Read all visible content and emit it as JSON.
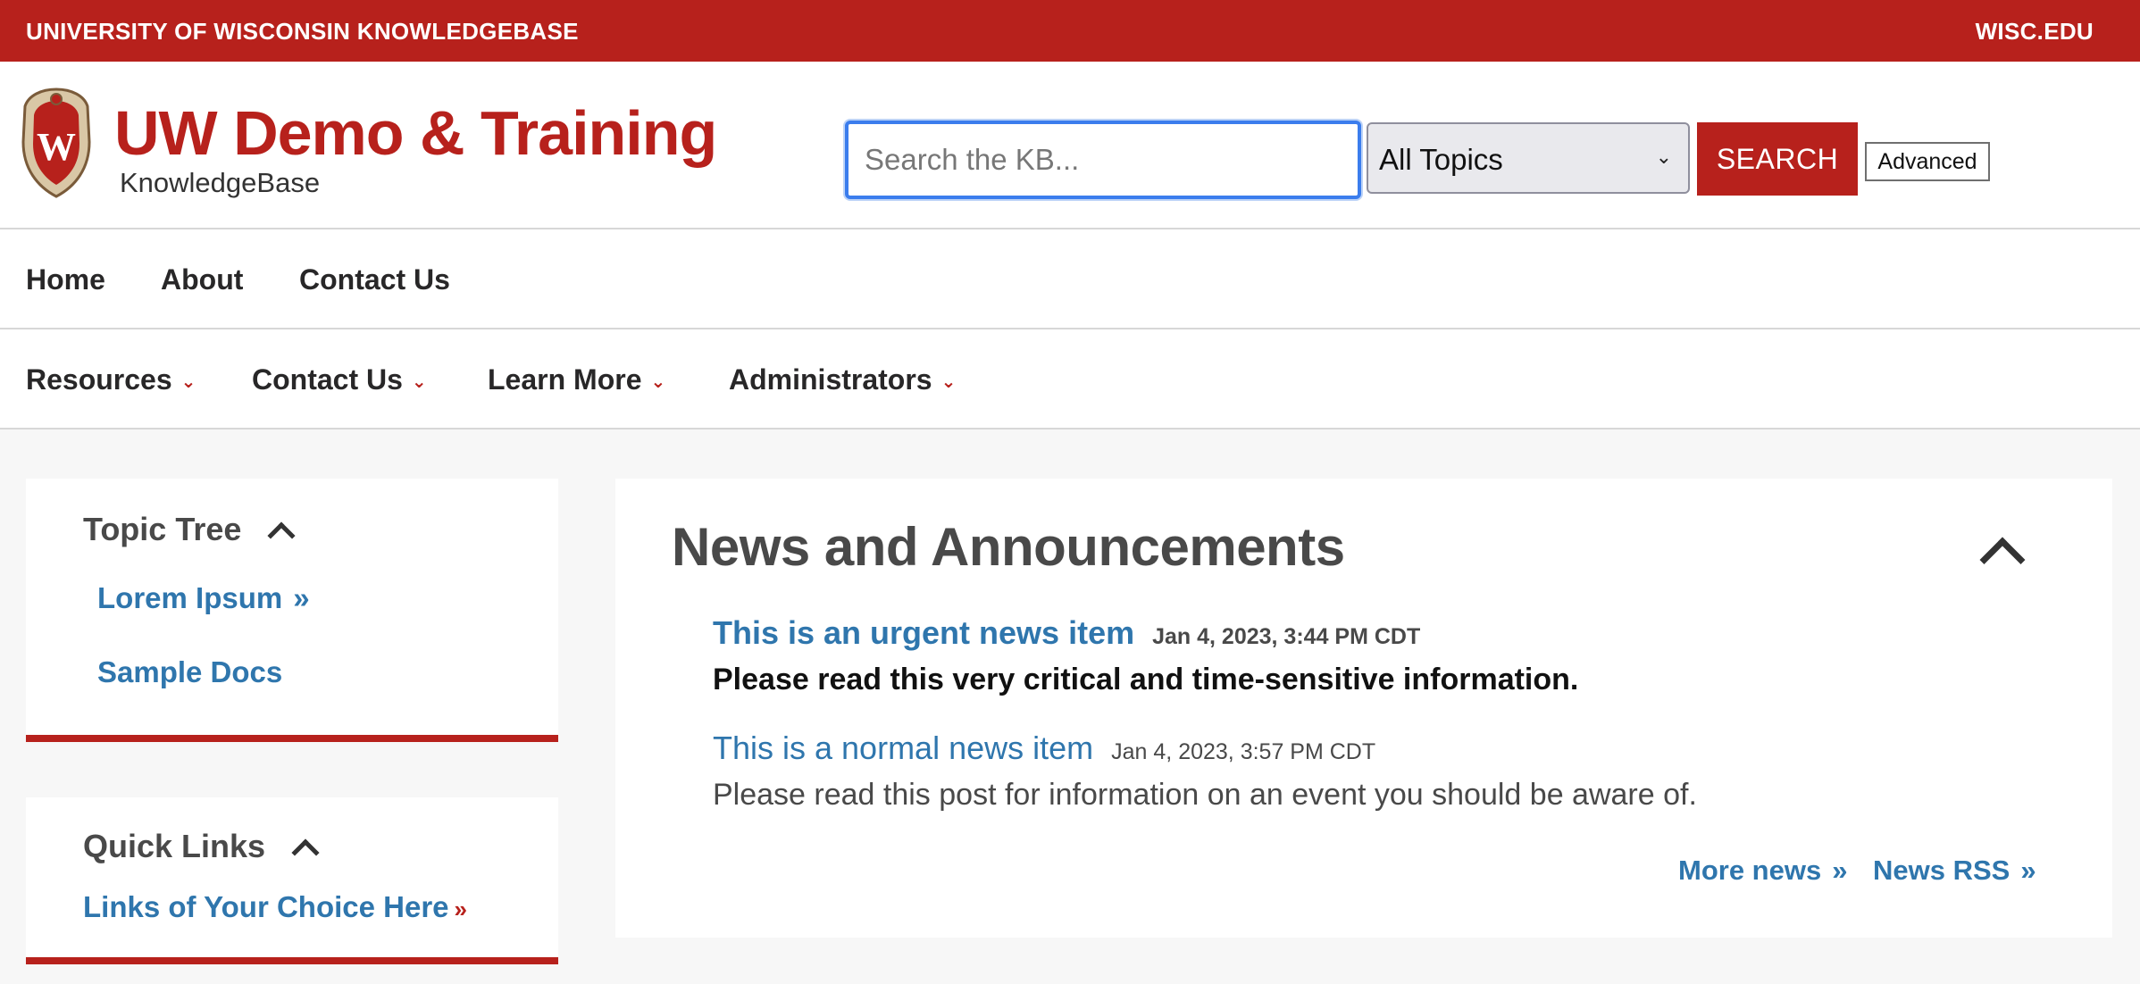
{
  "topbar": {
    "left": "UNIVERSITY OF WISCONSIN KNOWLEDGEBASE",
    "right": "WISC.EDU"
  },
  "header": {
    "title": "UW Demo & Training",
    "subtitle": "KnowledgeBase",
    "crest_letter": "W",
    "search_placeholder": "Search the KB...",
    "topic_selected": "All Topics",
    "search_label": "SEARCH",
    "advanced_label": "Advanced"
  },
  "nav_primary": [
    "Home",
    "About",
    "Contact Us"
  ],
  "nav_secondary": [
    "Resources",
    "Contact Us",
    "Learn More",
    "Administrators"
  ],
  "topic_tree": {
    "heading": "Topic Tree",
    "items": [
      "Lorem Ipsum",
      "Sample Docs"
    ]
  },
  "quick_links": {
    "heading": "Quick Links",
    "items": [
      "Links of Your Choice Here"
    ]
  },
  "news": {
    "heading": "News and Announcements",
    "items": [
      {
        "title": "This is an urgent news item",
        "date": "Jan 4, 2023, 3:44 PM CDT",
        "body": "Please read this very critical and time-sensitive information."
      },
      {
        "title": "This is a normal news item",
        "date": "Jan 4, 2023, 3:57 PM CDT",
        "body": "Please read this post for information on an event you should be aware of."
      }
    ],
    "more_news": "More news",
    "rss": "News RSS"
  },
  "colors": {
    "brand_red": "#b7211c",
    "link_blue": "#2f76ad",
    "focus_blue": "#3b7ded"
  }
}
